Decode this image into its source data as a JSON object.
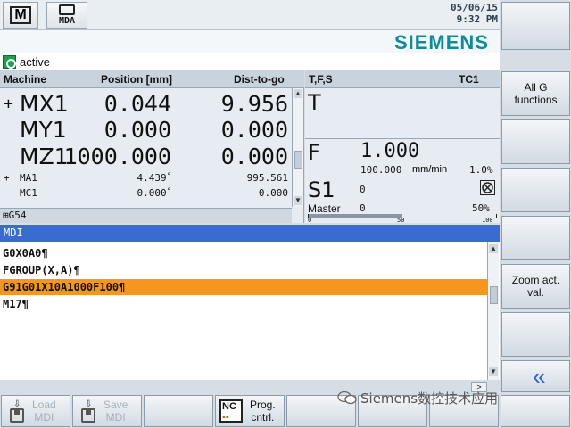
{
  "header": {
    "mode_machine": "M",
    "mode_mda": "MDA",
    "date": "05/06/15",
    "time": "9:32 PM",
    "brand": "SIEMENS"
  },
  "status": {
    "text": "active"
  },
  "machine": {
    "columns": {
      "axis": "Machine",
      "position": "Position [mm]",
      "dtg": "Dist-to-go"
    },
    "axes_big": [
      {
        "plus": "+",
        "name": "MX1",
        "position": "0.044",
        "dtg": "9.956"
      },
      {
        "plus": "",
        "name": "MY1",
        "position": "0.000",
        "dtg": "0.000"
      },
      {
        "plus": "",
        "name": "MZ1",
        "position": "1000.000",
        "dtg": "0.000"
      }
    ],
    "axes_small": [
      {
        "plus": "+",
        "name": "MA1",
        "position": "4.439",
        "unit": "°",
        "dtg": "995.561"
      },
      {
        "plus": "",
        "name": "MC1",
        "position": "0.000",
        "unit": "°",
        "dtg": "0.000"
      }
    ],
    "wcs": "G54"
  },
  "tfs": {
    "title": "T,F,S",
    "tool": "TC1",
    "t_label": "T",
    "f_label": "F",
    "feed_value": "1.000",
    "feed_set": "100.000",
    "feed_unit": "mm/min",
    "feed_override": "1.0%",
    "s_label": "S1",
    "speed_value": "0",
    "master_label": "Master",
    "master_value": "0",
    "spindle_override": "50%",
    "spindle_override_fraction": 0.5,
    "scale": [
      "0",
      "50",
      "100"
    ]
  },
  "mdi": {
    "title": "MDI",
    "lines": [
      "G0X0A0¶",
      "FGROUP(X,A)¶",
      "G91G01X10A1000F100¶",
      "M17¶"
    ],
    "selected_index": 2,
    "hscroll_label": ">"
  },
  "softkeys_right": [
    {
      "label": ""
    },
    {
      "label": "All G functions"
    },
    {
      "label": ""
    },
    {
      "label": ""
    },
    {
      "label": ""
    },
    {
      "label": "Zoom act. val."
    },
    {
      "label": ""
    },
    {
      "label": "«"
    }
  ],
  "softkeys_bottom": [
    {
      "label1": "Load",
      "label2": "MDI",
      "icon": "floppy-load-icon",
      "enabled": false
    },
    {
      "label1": "Save",
      "label2": "MDI",
      "icon": "floppy-save-icon",
      "enabled": false
    },
    {
      "label1": "",
      "label2": "",
      "icon": "",
      "enabled": true
    },
    {
      "label1": "Prog.",
      "label2": "cntrl.",
      "icon": "nc-program-control-icon",
      "enabled": true
    }
  ],
  "watermark": "Siemens数控技术应用",
  "colors": {
    "accent_blue": "#3a6bd1",
    "selection_orange": "#f6961e",
    "brand_teal": "#0f8c99",
    "status_green": "#1aa34a"
  }
}
